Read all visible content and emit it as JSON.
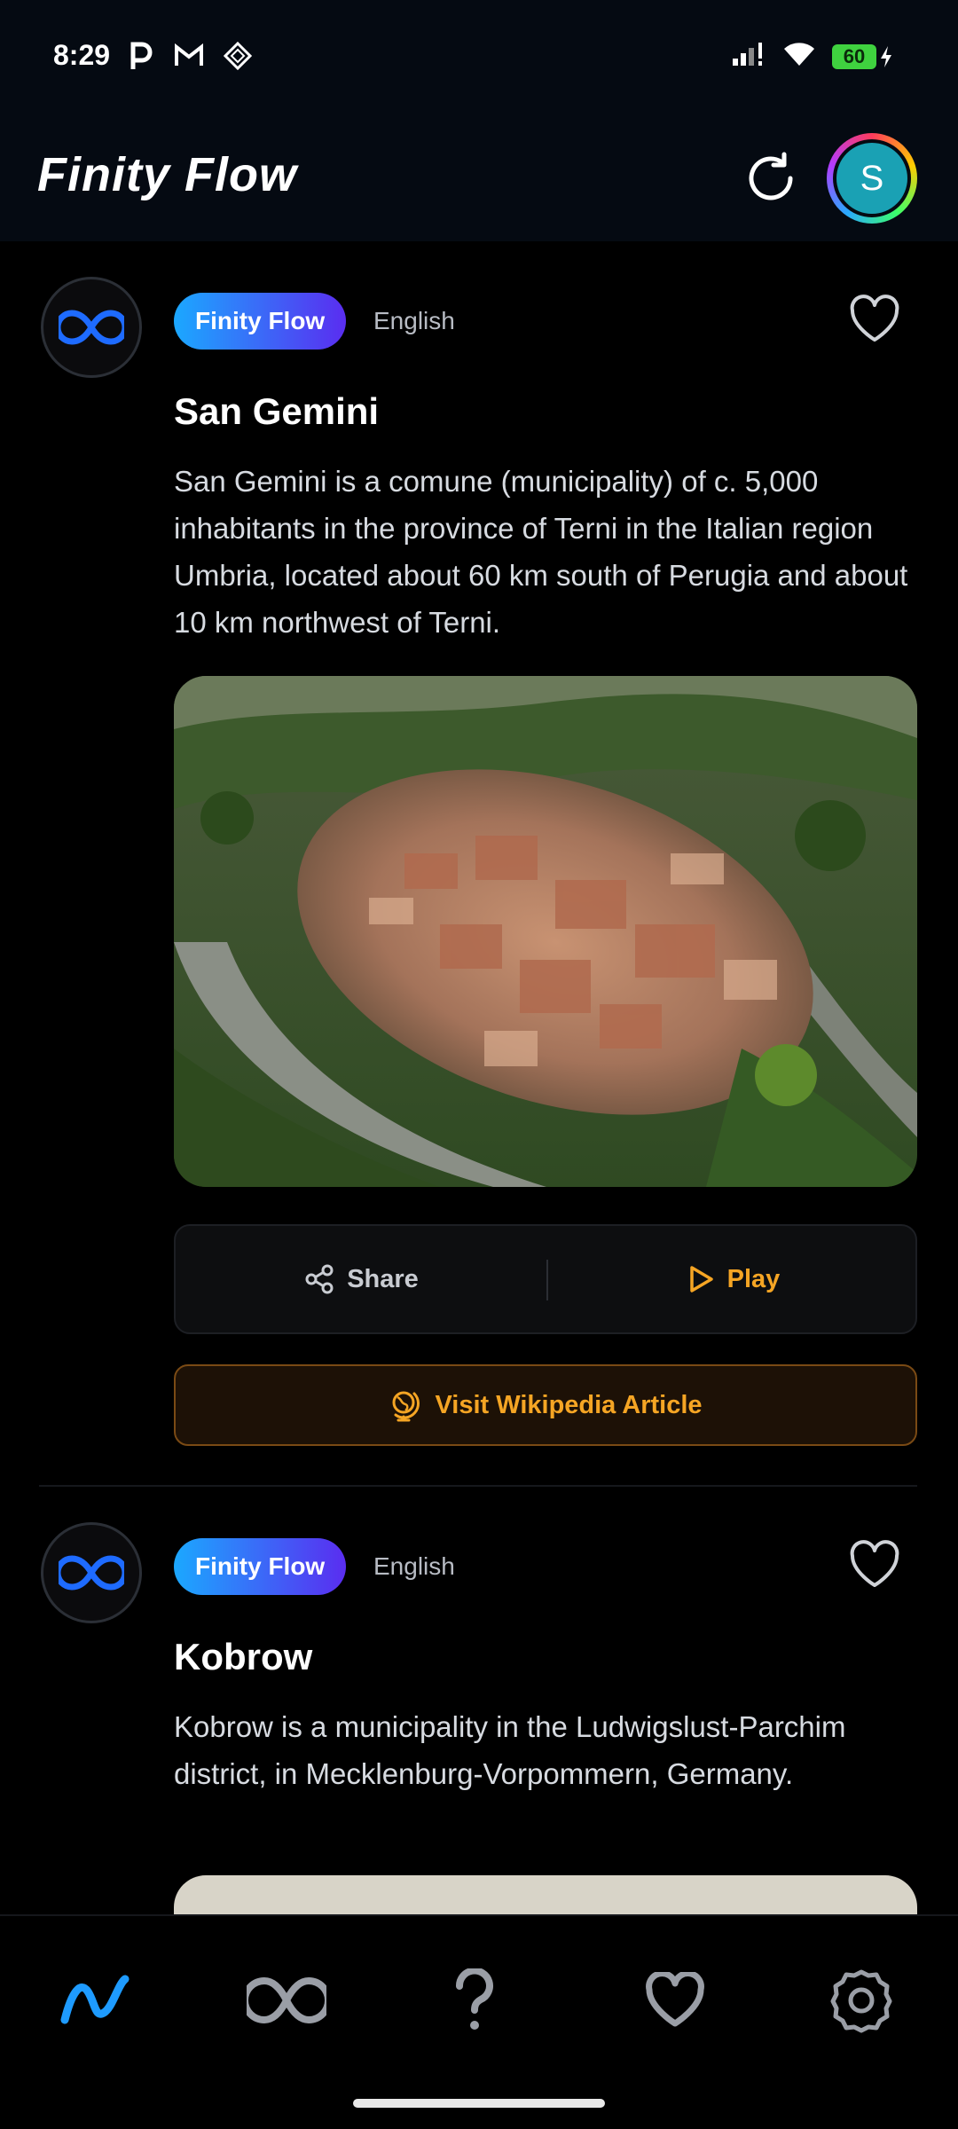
{
  "status_bar": {
    "time": "8:29",
    "left_icons": [
      "p-icon",
      "gmail-icon",
      "app-diamond-icon"
    ],
    "right_icons": [
      "signal-icon",
      "wifi-icon",
      "battery-icon"
    ],
    "battery_level": "60"
  },
  "header": {
    "title": "Finity Flow",
    "avatar_initial": "S",
    "colors": {
      "background": "#050a12",
      "avatar": "#1aa1b4"
    }
  },
  "posts": [
    {
      "source": "Finity Flow",
      "language": "English",
      "title": "San Gemini",
      "description": "San Gemini is a comune (municipality) of c. 5,000 inhabitants in the province of Terni in the Italian region Umbria, located about 60 km south of Perugia and about 10 km northwest of Terni.",
      "share_label": "Share",
      "play_label": "Play",
      "wiki_label": "Visit Wikipedia Article"
    },
    {
      "source": "Finity Flow",
      "language": "English",
      "title": "Kobrow",
      "description": "Kobrow is a municipality in the Ludwigslust-Parchim district, in Mecklenburg-Vorpommern, Germany."
    }
  ],
  "bottom_nav": {
    "items": [
      "feed-wave-icon",
      "infinity-icon",
      "question-icon",
      "heart-icon",
      "gear-icon"
    ],
    "active": "feed-wave-icon"
  },
  "colors": {
    "accent_orange": "#f5a524",
    "badge_gradient_start": "#1ba8ff",
    "badge_gradient_end": "#5a2df0",
    "active_nav": "#1e9bff"
  }
}
